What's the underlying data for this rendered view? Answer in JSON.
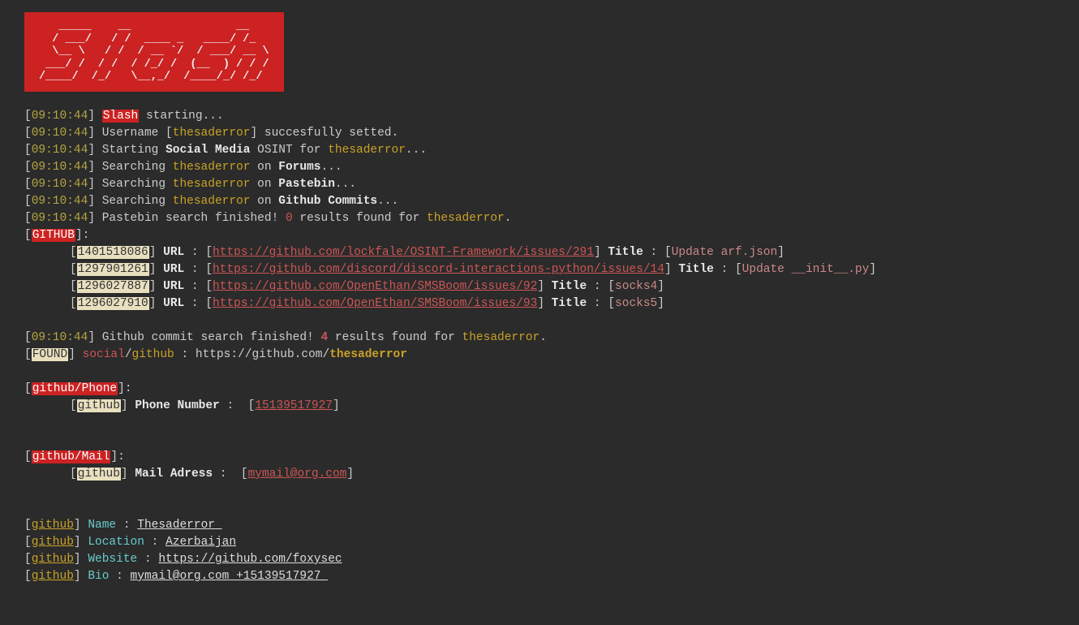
{
  "logo_ascii": "   _____    __                __\n  / ___/   / /  ____ _   ____/ /_\n  \\__ \\   / /  / __ `/  / ___/ __ \\\n ___/ /  / /  / /_/ /  (__  ) / / /\n/____/  /_/   \\__,_/  /____/_/ /_/",
  "ts": "09:10:44",
  "tool_name": "Slash",
  "starting_suffix": " starting...",
  "username_line": {
    "p1": "Username [",
    "user": "thesaderror",
    "p2": "] succesfully setted."
  },
  "starting_osint": {
    "p1": "Starting ",
    "sm": "Social Media",
    "p2": " OSINT for ",
    "user": "thesaderror",
    "p3": "..."
  },
  "search_forums": {
    "p1": "Searching ",
    "user": "thesaderror",
    "p2_pre": " on ",
    "tgt": "Forums",
    "p2_post": "..."
  },
  "search_pastebin": {
    "p1": "Searching ",
    "user": "thesaderror",
    "p2_pre": " on ",
    "tgt": "Pastebin",
    "p2_post": "..."
  },
  "search_commits": {
    "p1": "Searching ",
    "user": "thesaderror",
    "p2_pre": " on ",
    "tgt": "Github Commits",
    "p2_post": "..."
  },
  "pastebin_finished": {
    "p1": "Pastebin search finished! ",
    "zero": "0",
    "p2": " results found for ",
    "user": "thesaderror",
    "p3": "."
  },
  "github_tag": "GITHUB",
  "colon": ":",
  "results": [
    {
      "id": "1401518086",
      "url_label": "URL",
      "url": "https://github.com/lockfale/OSINT-Framework/issues/291",
      "title_label": "Title",
      "title": "Update arf.json"
    },
    {
      "id": "1297901261",
      "url_label": "URL",
      "url": "https://github.com/discord/discord-interactions-python/issues/14",
      "title_label": "Title",
      "title": "Update __init__.py"
    },
    {
      "id": "1296027887",
      "url_label": "URL",
      "url": "https://github.com/OpenEthan/SMSBoom/issues/92",
      "title_label": "Title",
      "title": "socks4"
    },
    {
      "id": "1296027910",
      "url_label": "URL",
      "url": "https://github.com/OpenEthan/SMSBoom/issues/93",
      "title_label": "Title",
      "title": "socks5"
    }
  ],
  "github_finished": {
    "p1": "Github commit search finished! ",
    "four": "4",
    "p2": " results found for ",
    "user": "thesaderror",
    "p3": "."
  },
  "found_tag": "FOUND",
  "found_line": {
    "social": "social",
    "slash": "/",
    "gh": "github",
    "p2": " : https://github.com/",
    "user": "thesaderror"
  },
  "section_phone_tag": "github/Phone",
  "phone_row": {
    "src": "github",
    "label": "Phone Number",
    "value": "15139517927"
  },
  "section_mail_tag": "github/Mail",
  "mail_row": {
    "src": "github",
    "label": "Mail Adress",
    "value": "mymail@org.com"
  },
  "profile": {
    "src": "github",
    "name_label": "Name",
    "name_value": "Thesaderror ",
    "loc_label": "Location",
    "loc_value": "Azerbaijan",
    "web_label": "Website",
    "web_value": "https://github.com/foxysec",
    "bio_label": "Bio",
    "bio_value": "mymail@org.com +15139517927 "
  },
  "sep": " : ",
  "lb": "[",
  "rb": "]"
}
